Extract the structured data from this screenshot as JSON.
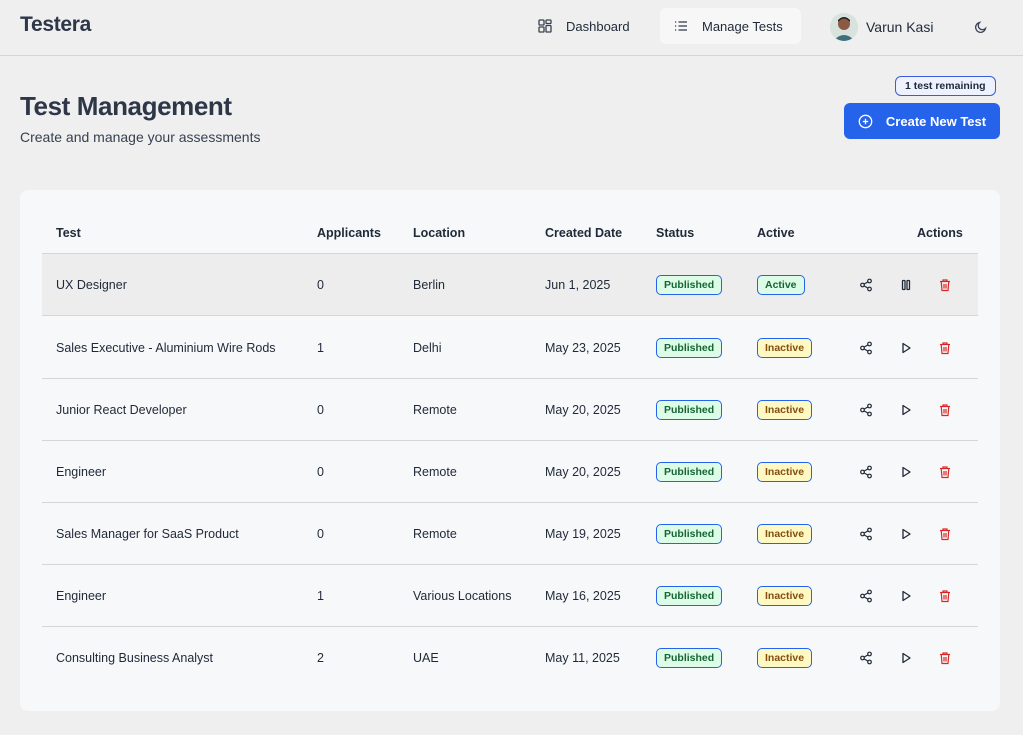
{
  "brand": "Testera",
  "nav": {
    "dashboard": "Dashboard",
    "manage_tests": "Manage Tests"
  },
  "user": {
    "name": "Varun Kasi"
  },
  "header": {
    "title": "Test Management",
    "subtitle": "Create and manage your assessments",
    "remaining_badge": "1 test remaining",
    "create_button": "Create New Test"
  },
  "table": {
    "columns": {
      "test": "Test",
      "applicants": "Applicants",
      "location": "Location",
      "created": "Created Date",
      "status": "Status",
      "active": "Active",
      "actions": "Actions"
    },
    "rows": [
      {
        "test": "UX Designer",
        "applicants": "0",
        "location": "Berlin",
        "created": "Jun 1, 2025",
        "status": "Published",
        "active": "Active",
        "toggle": "pause"
      },
      {
        "test": "Sales Executive - Aluminium Wire Rods",
        "applicants": "1",
        "location": "Delhi",
        "created": "May 23, 2025",
        "status": "Published",
        "active": "Inactive",
        "toggle": "play"
      },
      {
        "test": "Junior React Developer",
        "applicants": "0",
        "location": "Remote",
        "created": "May 20, 2025",
        "status": "Published",
        "active": "Inactive",
        "toggle": "play"
      },
      {
        "test": "Engineer",
        "applicants": "0",
        "location": "Remote",
        "created": "May 20, 2025",
        "status": "Published",
        "active": "Inactive",
        "toggle": "play"
      },
      {
        "test": "Sales Manager for SaaS Product",
        "applicants": "0",
        "location": "Remote",
        "created": "May 19, 2025",
        "status": "Published",
        "active": "Inactive",
        "toggle": "play"
      },
      {
        "test": "Engineer",
        "applicants": "1",
        "location": "Various Locations",
        "created": "May 16, 2025",
        "status": "Published",
        "active": "Inactive",
        "toggle": "play"
      },
      {
        "test": "Consulting Business Analyst",
        "applicants": "2",
        "location": "UAE",
        "created": "May 11, 2025",
        "status": "Published",
        "active": "Inactive",
        "toggle": "play"
      }
    ]
  },
  "icons": {
    "dashboard": "grid-icon",
    "manage_tests": "list-icon",
    "theme": "moon-icon",
    "create": "plus-circle-icon",
    "share": "share-icon",
    "pause": "pause-icon",
    "play": "play-icon",
    "delete": "trash-icon"
  },
  "colors": {
    "accent": "#2563eb",
    "delete": "#dc2626",
    "published_bg": "#dcfce7",
    "inactive_bg": "#fef9c3"
  }
}
